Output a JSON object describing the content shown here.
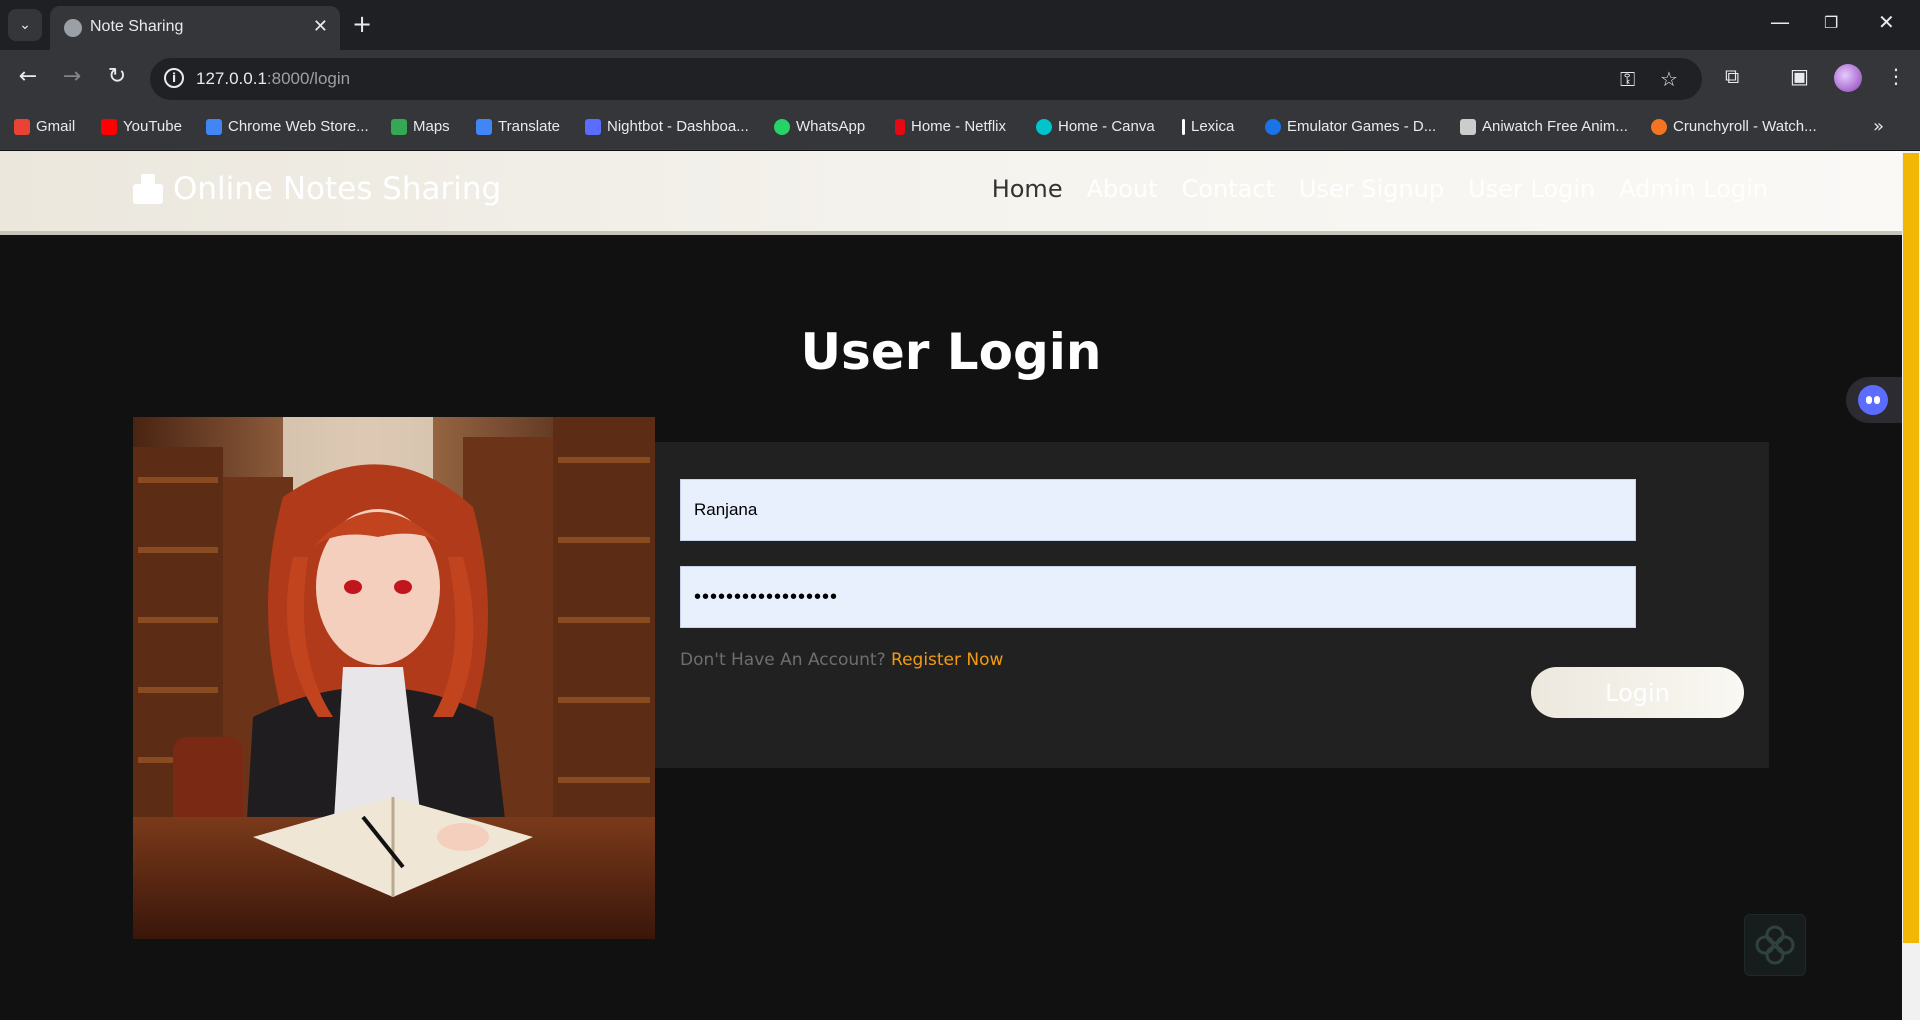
{
  "browser": {
    "tab_title": "Note Sharing",
    "tab_close": "✕",
    "new_tab": "+",
    "url_host": "127.0.0.1",
    "url_path": ":8000/login",
    "bookmarks": [
      {
        "label": "Gmail",
        "color": "#ea4335"
      },
      {
        "label": "YouTube",
        "color": "#ff0000"
      },
      {
        "label": "Chrome Web Store...",
        "color": "#4285f4"
      },
      {
        "label": "Maps",
        "color": "#34a853"
      },
      {
        "label": "Translate",
        "color": "#4285f4"
      },
      {
        "label": "Nightbot - Dashboa...",
        "color": "#5b6cff"
      },
      {
        "label": "WhatsApp",
        "color": "#25d366"
      },
      {
        "label": "Home - Netflix",
        "color": "#e50914"
      },
      {
        "label": "Home - Canva",
        "color": "#00c4cc"
      },
      {
        "label": "Lexica",
        "color": "#ffffff"
      },
      {
        "label": "Emulator Games - D...",
        "color": "#1a73e8"
      },
      {
        "label": "Aniwatch Free Anim...",
        "color": "#cccccc"
      },
      {
        "label": "Crunchyroll - Watch...",
        "color": "#f47521"
      }
    ]
  },
  "site": {
    "brand": "Online Notes Sharing",
    "nav": [
      "Home",
      "About",
      "Contact",
      "User Signup",
      "User Login",
      "Admin Login"
    ],
    "heading": "User Login",
    "username_value": "Ranjana",
    "password_value": "••••••••••••••••••",
    "signup_prompt": "Don't Have An Account?",
    "register_link": "Register Now",
    "login_button": "Login"
  },
  "colors": {
    "accent_orange": "#f39c12",
    "scroll_thumb": "#f2b705"
  }
}
